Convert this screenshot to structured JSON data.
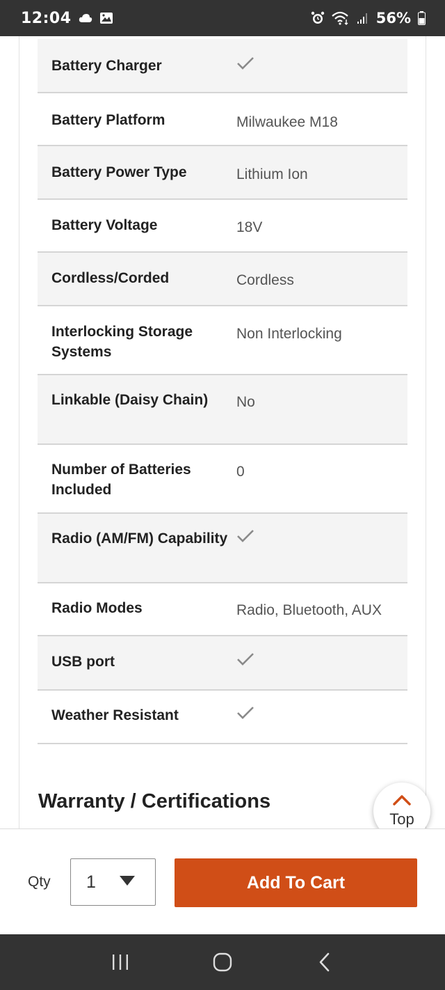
{
  "status_bar": {
    "time": "12:04",
    "battery_percent": "56%",
    "left_icons": [
      "cloud-icon",
      "gallery-icon"
    ],
    "right_icons": [
      "alarm-icon",
      "wifi-icon",
      "signal-icon",
      "battery-icon"
    ]
  },
  "specifications": [
    {
      "name": "Battery Charger",
      "value": null,
      "check": true
    },
    {
      "name": "Battery Platform",
      "value": "Milwaukee M18",
      "check": false
    },
    {
      "name": "Battery Power Type",
      "value": "Lithium Ion",
      "check": false
    },
    {
      "name": "Battery Voltage",
      "value": "18V",
      "check": false
    },
    {
      "name": "Cordless/Corded",
      "value": "Cordless",
      "check": false
    },
    {
      "name": "Interlocking Storage Systems",
      "value": "Non Interlocking",
      "check": false
    },
    {
      "name": "Linkable (Daisy Chain)",
      "value": "No",
      "check": false
    },
    {
      "name": "Number of Batteries Included",
      "value": "0",
      "check": false
    },
    {
      "name": "Radio (AM/FM) Capability",
      "value": null,
      "check": true
    },
    {
      "name": "Radio Modes",
      "value": "Radio, Bluetooth, AUX",
      "check": false
    },
    {
      "name": "USB port",
      "value": null,
      "check": true
    },
    {
      "name": "Weather Resistant",
      "value": null,
      "check": true
    }
  ],
  "section": {
    "warranty_heading": "Warranty / Certifications"
  },
  "top_button": {
    "label": "Top"
  },
  "purchase": {
    "qty_label": "Qty",
    "qty_value": "1",
    "add_to_cart_label": "Add To Cart",
    "accent_color": "#d04e17"
  },
  "nav_bar": {
    "buttons": [
      "recents-icon",
      "home-icon",
      "back-icon"
    ]
  }
}
